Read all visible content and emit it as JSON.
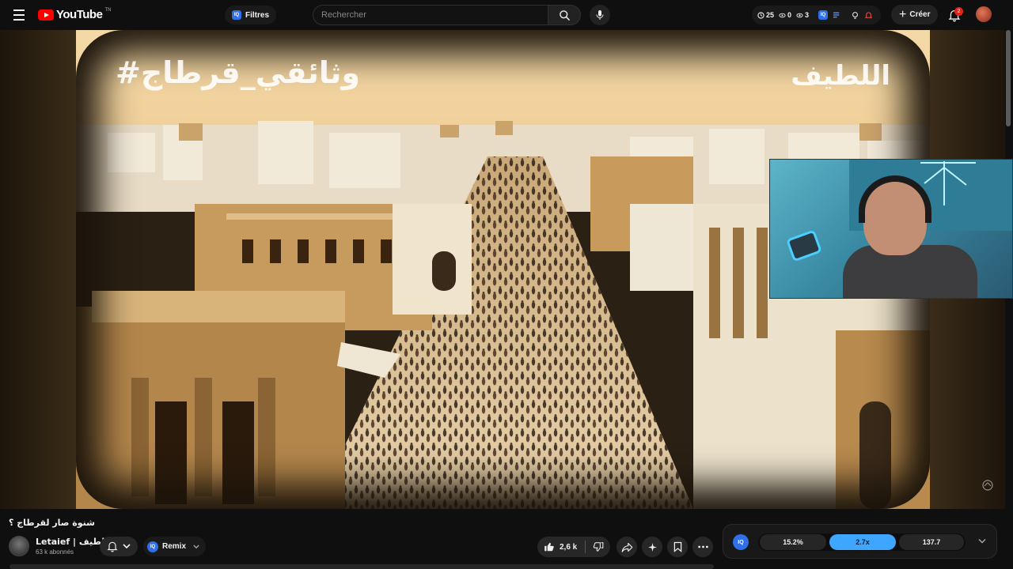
{
  "header": {
    "logo_text": "YouTube",
    "logo_tm": "TN",
    "filters_label": "Filtres",
    "search_placeholder": "Rechercher",
    "stats": [
      {
        "icon": "clock-icon",
        "value": "25"
      },
      {
        "icon": "eye-off-icon",
        "value": "0"
      },
      {
        "icon": "eye-icon",
        "value": "3"
      }
    ],
    "create_label": "Créer",
    "notification_count": "2"
  },
  "video": {
    "overlay_hashtag": "#وثائقي_قرطاج",
    "overlay_name": "اللطيف",
    "title": "شنوة صار لقرطاج ؟"
  },
  "channel": {
    "name": "Letaief | اللطيف",
    "subscribers": "63 k abonnés"
  },
  "actions": {
    "remix_label": "Remix",
    "like_count": "2,6 k"
  },
  "speed_panel": {
    "segments": [
      "15.2%",
      "2.7x",
      "137.7"
    ],
    "active_index": 1
  },
  "colors": {
    "accent": "#3ea6ff",
    "brand_red": "#ff0000",
    "iq_blue": "#2f6fe8",
    "background": "#0f0f0f"
  }
}
